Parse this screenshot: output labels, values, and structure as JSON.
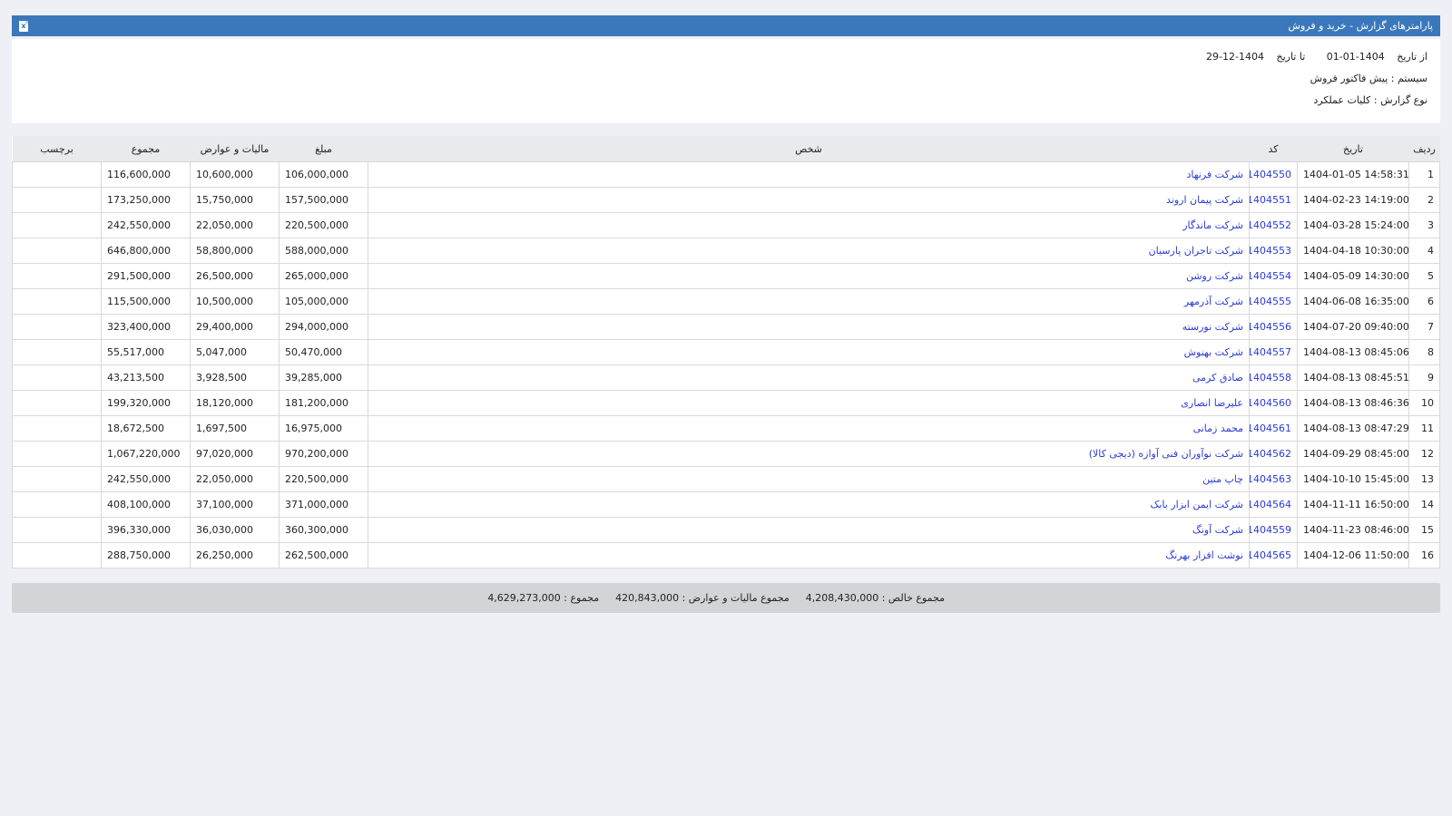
{
  "header": {
    "title": "پارامترهای گزارش - خرید و فروش",
    "export_icon": "excel-icon"
  },
  "params": {
    "from_label": "از تاریخ",
    "from_value": "1404-01-01",
    "to_label": "تا تاریخ",
    "to_value": "1404-12-29",
    "system_line": "سیستم : پیش فاکتور فروش",
    "type_line": "نوع گزارش : کلیات عملکرد"
  },
  "table": {
    "columns": [
      "ردیف",
      "تاریخ",
      "کد",
      "شخص",
      "مبلغ",
      "مالیات و عوارض",
      "مجموع",
      "برچسب"
    ],
    "rows": [
      {
        "row": "1",
        "date": "1404-01-05 14:58:31",
        "code": "1404550",
        "person": "شرکت فرنهاد",
        "amount": "106,000,000",
        "tax": "10,600,000",
        "total": "116,600,000",
        "tag": ""
      },
      {
        "row": "2",
        "date": "1404-02-23 14:19:00",
        "code": "1404551",
        "person": "شرکت پیمان اروند",
        "amount": "157,500,000",
        "tax": "15,750,000",
        "total": "173,250,000",
        "tag": ""
      },
      {
        "row": "3",
        "date": "1404-03-28 15:24:00",
        "code": "1404552",
        "person": "شرکت ماندگار",
        "amount": "220,500,000",
        "tax": "22,050,000",
        "total": "242,550,000",
        "tag": ""
      },
      {
        "row": "4",
        "date": "1404-04-18 10:30:00",
        "code": "1404553",
        "person": "شرکت تاجران پارسیان",
        "amount": "588,000,000",
        "tax": "58,800,000",
        "total": "646,800,000",
        "tag": ""
      },
      {
        "row": "5",
        "date": "1404-05-09 14:30:00",
        "code": "1404554",
        "person": "شرکت روشن",
        "amount": "265,000,000",
        "tax": "26,500,000",
        "total": "291,500,000",
        "tag": ""
      },
      {
        "row": "6",
        "date": "1404-06-08 16:35:00",
        "code": "1404555",
        "person": "شرکت آذرمهر",
        "amount": "105,000,000",
        "tax": "10,500,000",
        "total": "115,500,000",
        "tag": ""
      },
      {
        "row": "7",
        "date": "1404-07-20 09:40:00",
        "code": "1404556",
        "person": "شرکت نورسته",
        "amount": "294,000,000",
        "tax": "29,400,000",
        "total": "323,400,000",
        "tag": ""
      },
      {
        "row": "8",
        "date": "1404-08-13 08:45:06",
        "code": "1404557",
        "person": "شرکت بهنوش",
        "amount": "50,470,000",
        "tax": "5,047,000",
        "total": "55,517,000",
        "tag": ""
      },
      {
        "row": "9",
        "date": "1404-08-13 08:45:51",
        "code": "1404558",
        "person": "صادق کرمی",
        "amount": "39,285,000",
        "tax": "3,928,500",
        "total": "43,213,500",
        "tag": ""
      },
      {
        "row": "10",
        "date": "1404-08-13 08:46:36",
        "code": "1404560",
        "person": "علیرضا انصاری",
        "amount": "181,200,000",
        "tax": "18,120,000",
        "total": "199,320,000",
        "tag": ""
      },
      {
        "row": "11",
        "date": "1404-08-13 08:47:29",
        "code": "1404561",
        "person": "محمد زمانی",
        "amount": "16,975,000",
        "tax": "1,697,500",
        "total": "18,672,500",
        "tag": ""
      },
      {
        "row": "12",
        "date": "1404-09-29 08:45:00",
        "code": "1404562",
        "person": "شرکت نوآوران فنی آوازه (دیجی کالا)",
        "amount": "970,200,000",
        "tax": "97,020,000",
        "total": "1,067,220,000",
        "tag": ""
      },
      {
        "row": "13",
        "date": "1404-10-10 15:45:00",
        "code": "1404563",
        "person": "چاپ متین",
        "amount": "220,500,000",
        "tax": "22,050,000",
        "total": "242,550,000",
        "tag": ""
      },
      {
        "row": "14",
        "date": "1404-11-11 16:50:00",
        "code": "1404564",
        "person": "شرکت ایمن ابزار بابک",
        "amount": "371,000,000",
        "tax": "37,100,000",
        "total": "408,100,000",
        "tag": ""
      },
      {
        "row": "15",
        "date": "1404-11-23 08:46:00",
        "code": "1404559",
        "person": "شرکت آونگ",
        "amount": "360,300,000",
        "tax": "36,030,000",
        "total": "396,330,000",
        "tag": ""
      },
      {
        "row": "16",
        "date": "1404-12-06 11:50:00",
        "code": "1404565",
        "person": "نوشت افزار بهرنگ",
        "amount": "262,500,000",
        "tax": "26,250,000",
        "total": "288,750,000",
        "tag": ""
      }
    ]
  },
  "footer": {
    "net_total": "مجموع خالص : 4,208,430,000",
    "tax_total": "مجموع مالیات و عوارض : 420,843,000",
    "grand_total": "مجموع : 4,629,273,000"
  },
  "colors": {
    "header_bg": "#3b78bb",
    "link": "#2a3bd6",
    "footer_bg": "#d3d4d7"
  }
}
